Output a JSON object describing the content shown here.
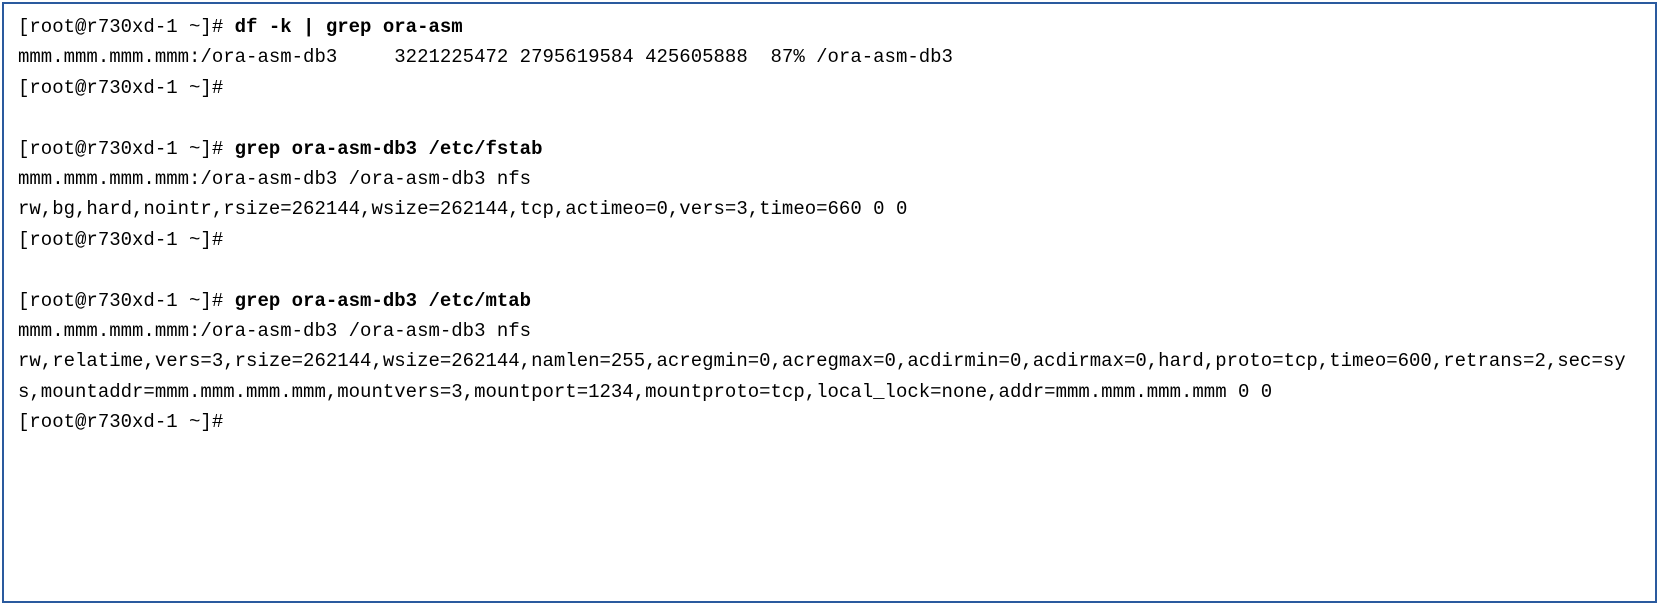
{
  "blocks": [
    {
      "prompt": "[root@r730xd-1 ~]# ",
      "command": "df -k | grep ora-asm",
      "output": [
        "mmm.mmm.mmm.mmm:/ora-asm-db3     3221225472 2795619584 425605888  87% /ora-asm-db3"
      ],
      "trailing_prompt": "[root@r730xd-1 ~]#"
    },
    {
      "prompt": "[root@r730xd-1 ~]# ",
      "command": "grep ora-asm-db3 /etc/fstab",
      "output": [
        "mmm.mmm.mmm.mmm:/ora-asm-db3 /ora-asm-db3 nfs",
        "rw,bg,hard,nointr,rsize=262144,wsize=262144,tcp,actimeo=0,vers=3,timeo=660 0 0"
      ],
      "trailing_prompt": "[root@r730xd-1 ~]#"
    },
    {
      "prompt": "[root@r730xd-1 ~]# ",
      "command": "grep ora-asm-db3 /etc/mtab",
      "output": [
        "mmm.mmm.mmm.mmm:/ora-asm-db3 /ora-asm-db3 nfs",
        "rw,relatime,vers=3,rsize=262144,wsize=262144,namlen=255,acregmin=0,acregmax=0,acdirmin=0,acdirmax=0,hard,proto=tcp,timeo=600,retrans=2,sec=sys,mountaddr=mmm.mmm.mmm.mmm,mountvers=3,mountport=1234,mountproto=tcp,local_lock=none,addr=mmm.mmm.mmm.mmm 0 0"
      ],
      "trailing_prompt": "[root@r730xd-1 ~]#"
    }
  ]
}
